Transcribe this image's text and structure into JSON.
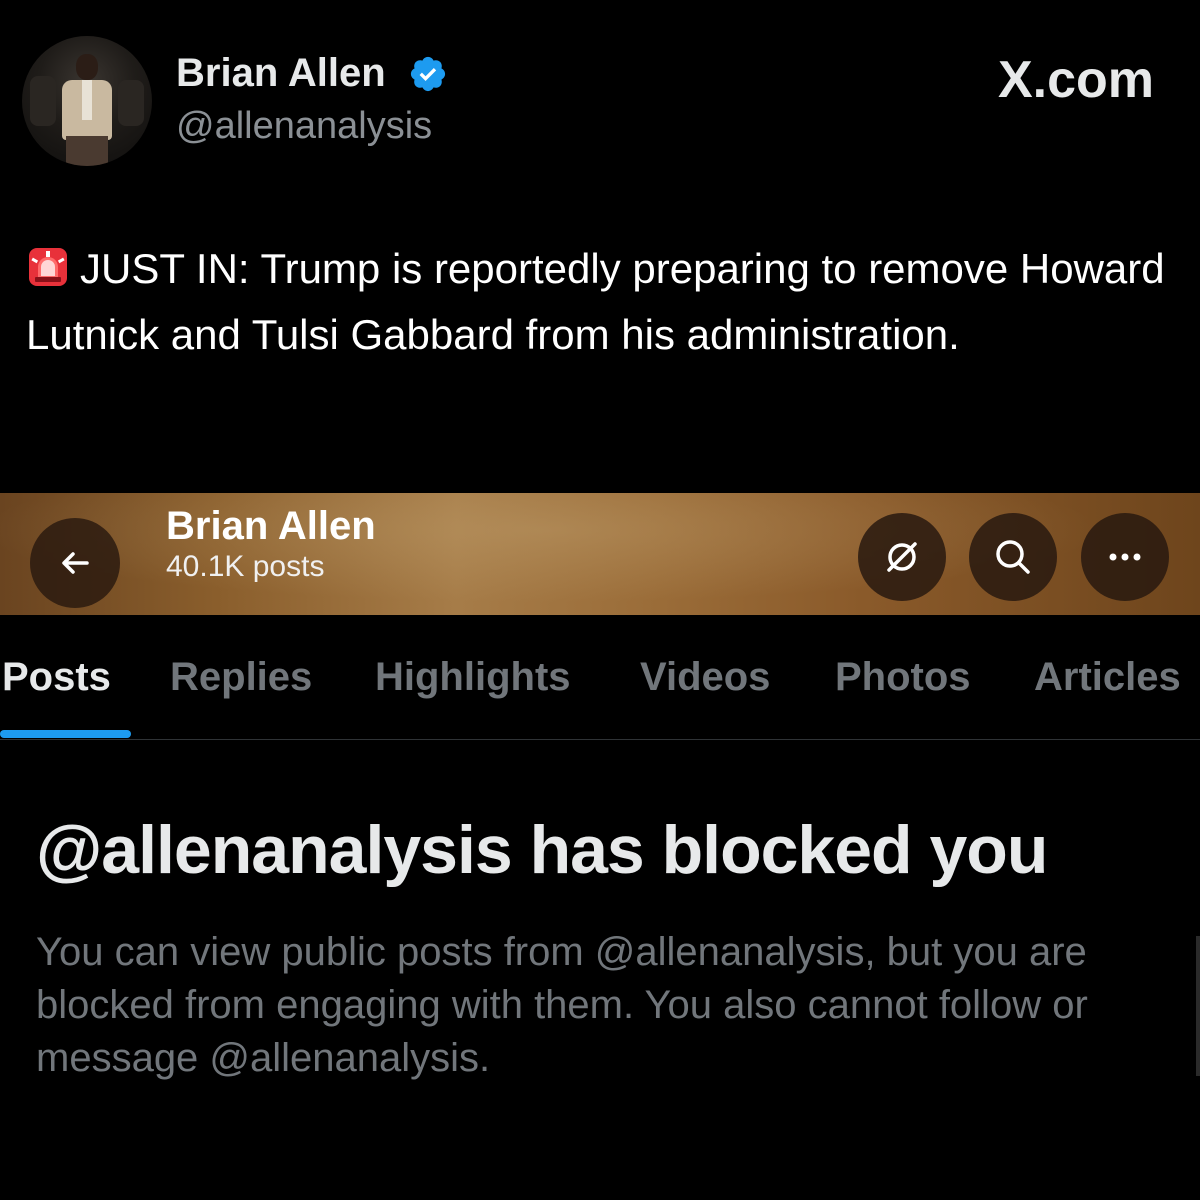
{
  "tweet": {
    "display_name": "Brian Allen",
    "verified_icon": "verified-badge-icon",
    "handle": "@allenanalysis",
    "brand": "X.com",
    "siren_icon": "rotating-light-icon",
    "text": "JUST IN: Trump is reportedly preparing to remove Howard Lutnick and Tulsi Gabbard from his administration."
  },
  "profile_bar": {
    "name": "Brian Allen",
    "post_count": "40.1K posts",
    "back_icon": "arrow-left-icon",
    "grok_icon": "grok-icon",
    "search_icon": "search-icon",
    "more_icon": "more-horizontal-icon"
  },
  "tabs": [
    {
      "label": "Posts",
      "active": true
    },
    {
      "label": "Replies",
      "active": false
    },
    {
      "label": "Highlights",
      "active": false
    },
    {
      "label": "Videos",
      "active": false
    },
    {
      "label": "Photos",
      "active": false
    },
    {
      "label": "Articles",
      "active": false
    }
  ],
  "blocked": {
    "title": "@allenanalysis has blocked you",
    "body": "You can view public posts from @allenanalysis, but you are blocked from engaging with them. You also cannot follow or message @allenanalysis."
  },
  "colors": {
    "accent": "#1d9bf0",
    "background": "#000000",
    "secondary_text": "#71767b"
  }
}
